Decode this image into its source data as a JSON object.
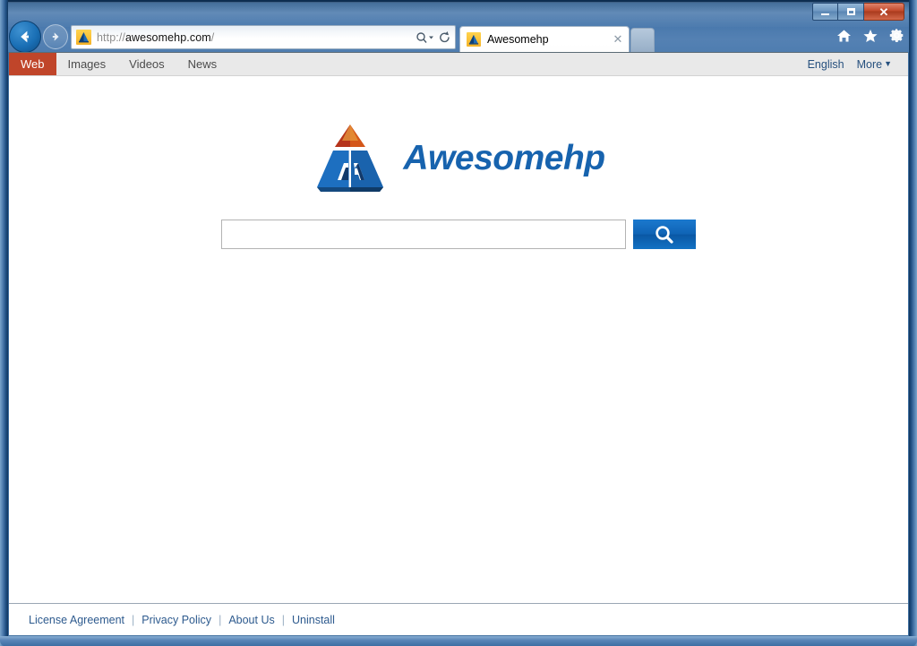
{
  "window": {
    "controls": {
      "minimize_label": "Minimize",
      "maximize_label": "Maximize",
      "close_label": "Close",
      "close_glyph": "✕"
    },
    "close_button_color": "#c34a2c"
  },
  "browser": {
    "back_label": "Back",
    "forward_label": "Forward",
    "address": {
      "scheme": "http://",
      "host": "awesomehp.com",
      "trailing": "/",
      "full_url": "http://awesomehp.com/",
      "placeholder": "",
      "favicon_name": "awesomehp-favicon",
      "search_dropdown_label": "Search",
      "refresh_label": "Refresh"
    },
    "tabs": [
      {
        "title": "Awesomehp",
        "favicon_name": "awesomehp-favicon",
        "close_glyph": "✕",
        "active": true
      }
    ],
    "new_tab_label": "New tab",
    "command_icons": [
      {
        "name": "home-icon",
        "label": "Home"
      },
      {
        "name": "favorites-star-icon",
        "label": "Favorites"
      },
      {
        "name": "settings-gear-icon",
        "label": "Tools"
      }
    ]
  },
  "site": {
    "nav_tabs": [
      {
        "label": "Web",
        "active": true
      },
      {
        "label": "Images",
        "active": false
      },
      {
        "label": "Videos",
        "active": false
      },
      {
        "label": "News",
        "active": false
      }
    ],
    "nav_right": {
      "language_label": "English",
      "more_label": "More",
      "more_caret": "▼"
    },
    "logo": {
      "wordmark": "Awesomehp",
      "mark_name": "awesomehp-pyramid-logo",
      "wordmark_color": "#1763ae",
      "pyramid_blue": "#1d6fc0",
      "pyramid_dark_blue": "#103a6b",
      "pyramid_top_orange": "#e06a1a",
      "pyramid_top_red": "#b5341c"
    },
    "search": {
      "value": "",
      "placeholder": "",
      "button_label": "Search",
      "button_icon": "search-magnifier-icon",
      "button_color": "#0f63b5"
    },
    "footer_links": [
      "License Agreement",
      "Privacy Policy",
      "About Us",
      "Uninstall"
    ],
    "footer_separator": "|"
  },
  "theme": {
    "active_tab_bg": "#c0452a",
    "nav_bar_bg": "#e9e9e9",
    "link_blue": "#2d5a8e",
    "frame_blue": "#4e7cae"
  }
}
